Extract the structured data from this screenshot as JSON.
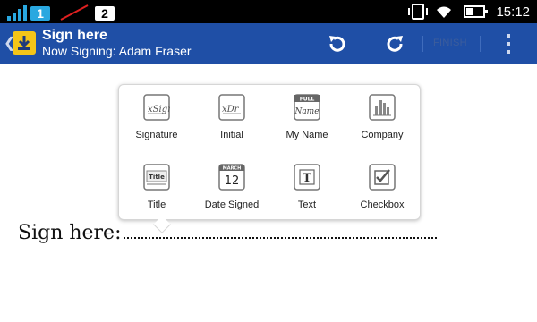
{
  "status_bar": {
    "sim1_label": "1",
    "sim2_label": "2",
    "time": "15:12",
    "icons": [
      "signal-icon",
      "no-signal-icon",
      "vibrate-icon",
      "wifi-icon",
      "battery-icon"
    ]
  },
  "app_bar": {
    "title": "Sign here",
    "subtitle": "Now Signing: Adam Fraser",
    "finish_label": "FINISH",
    "accent_color": "#1f4fa6"
  },
  "tools": [
    {
      "label": "Signature",
      "icon": "signature-icon"
    },
    {
      "label": "Initial",
      "icon": "initial-icon"
    },
    {
      "label": "My Name",
      "icon": "my-name-icon",
      "icon_caption": "FULL",
      "icon_text": "Name"
    },
    {
      "label": "Company",
      "icon": "company-icon"
    },
    {
      "label": "Title",
      "icon": "title-icon",
      "icon_text": "Title"
    },
    {
      "label": "Date Signed",
      "icon": "calendar-icon",
      "icon_caption": "MARCH",
      "icon_text": "12"
    },
    {
      "label": "Text",
      "icon": "text-icon",
      "icon_text": "T"
    },
    {
      "label": "Checkbox",
      "icon": "checkbox-icon"
    }
  ],
  "document": {
    "sign_label": "Sign here:"
  }
}
